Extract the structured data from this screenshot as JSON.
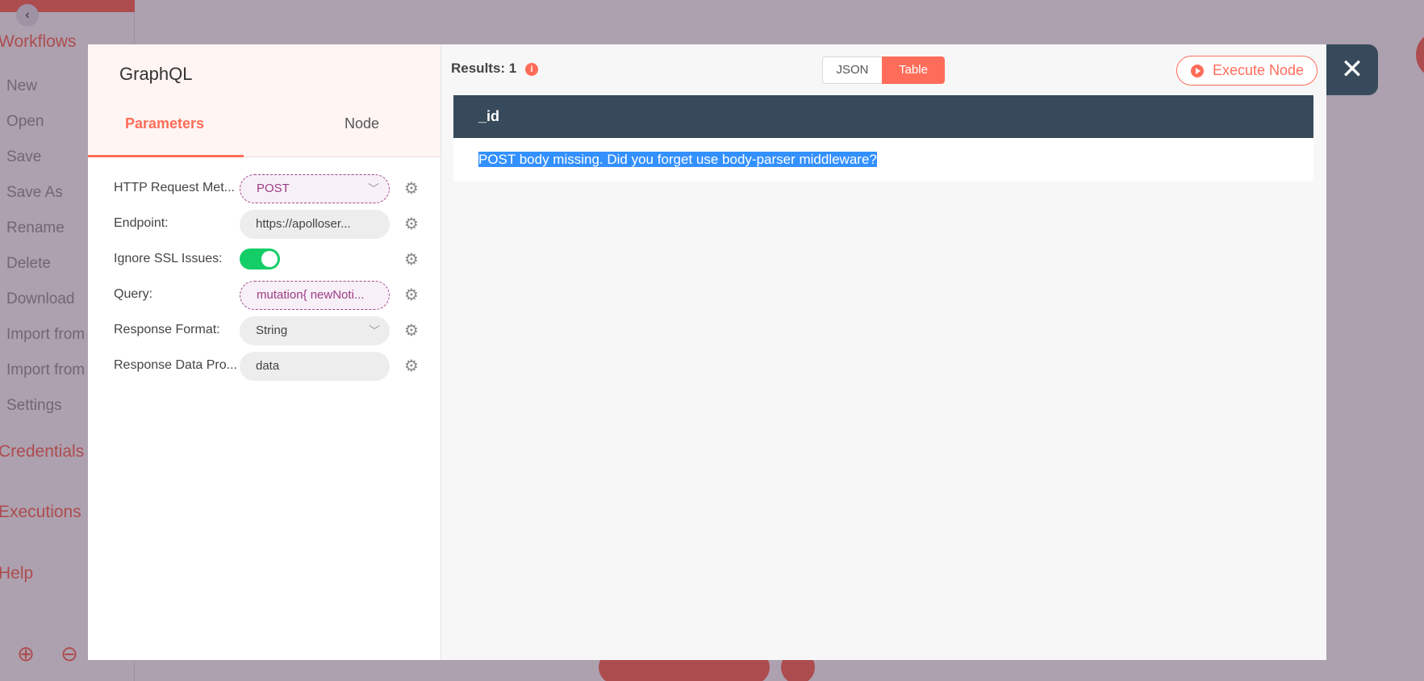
{
  "background": {
    "sidebar_collapse_icon": "chevron-left-icon",
    "sections": [
      "Workflows",
      "Credentials",
      "Executions",
      "Help"
    ],
    "workflow_items": [
      "New",
      "Open",
      "Save",
      "Save As",
      "Rename",
      "Delete",
      "Download",
      "Import from",
      "Import from",
      "Settings"
    ],
    "zoom_in_icon": "zoom-in-icon",
    "zoom_out_icon": "zoom-out-icon"
  },
  "node": {
    "title": "GraphQL",
    "tabs": [
      {
        "label": "Parameters",
        "active": true
      },
      {
        "label": "Node",
        "active": false
      }
    ],
    "parameters": [
      {
        "label": "HTTP Request Met...",
        "value": "POST",
        "kind": "select-expression"
      },
      {
        "label": "Endpoint:",
        "value": "https://apolloser...",
        "kind": "input"
      },
      {
        "label": "Ignore SSL Issues:",
        "value": "on",
        "kind": "toggle"
      },
      {
        "label": "Query:",
        "value": "mutation{  newNoti...",
        "kind": "expression"
      },
      {
        "label": "Response Format:",
        "value": "String",
        "kind": "select"
      },
      {
        "label": "Response Data Pro...",
        "value": "data",
        "kind": "input"
      }
    ]
  },
  "results": {
    "label": "Results: 1",
    "view_modes": [
      "JSON",
      "Table"
    ],
    "active_view": "Table",
    "execute_label": "Execute Node",
    "table": {
      "columns": [
        "_id"
      ],
      "rows": [
        [
          "POST body missing. Did you forget use body-parser middleware?"
        ]
      ]
    }
  },
  "colors": {
    "accent": "#ff6d5a",
    "header_dark": "#374a5b",
    "toggle_on": "#13ce66",
    "expression": "#9b3d84",
    "selection": "#3390ff"
  }
}
